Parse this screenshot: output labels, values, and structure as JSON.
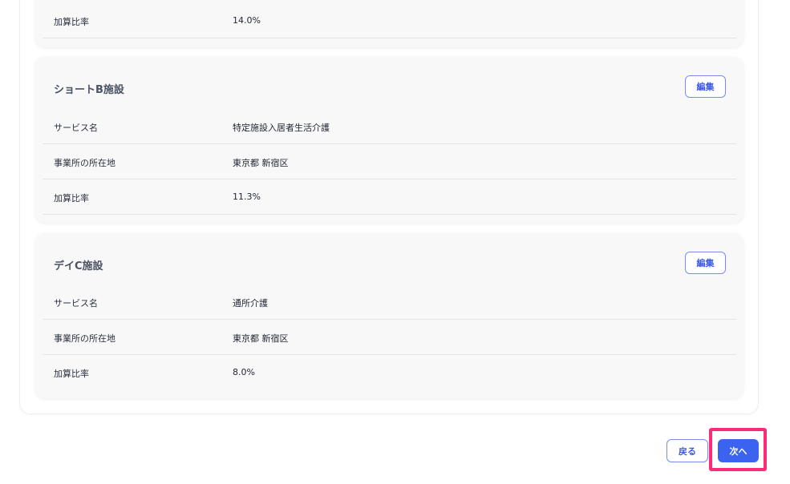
{
  "card0": {
    "rows": [
      {
        "key": "加算比率",
        "value": "14.0%"
      }
    ]
  },
  "card1": {
    "title": "ショートB施設",
    "edit_label": "編集",
    "rows": [
      {
        "key": "サービス名",
        "value": "特定施設入居者生活介護"
      },
      {
        "key": "事業所の所在地",
        "value": "東京都 新宿区"
      },
      {
        "key": "加算比率",
        "value": "11.3%"
      }
    ]
  },
  "card2": {
    "title": "デイC施設",
    "edit_label": "編集",
    "rows": [
      {
        "key": "サービス名",
        "value": "通所介護"
      },
      {
        "key": "事業所の所在地",
        "value": "東京都 新宿区"
      },
      {
        "key": "加算比率",
        "value": "8.0%"
      }
    ]
  },
  "footer": {
    "back_label": "戻る",
    "next_label": "次へ"
  },
  "colors": {
    "accent": "#3a63f0",
    "highlight": "#ff2a79"
  }
}
